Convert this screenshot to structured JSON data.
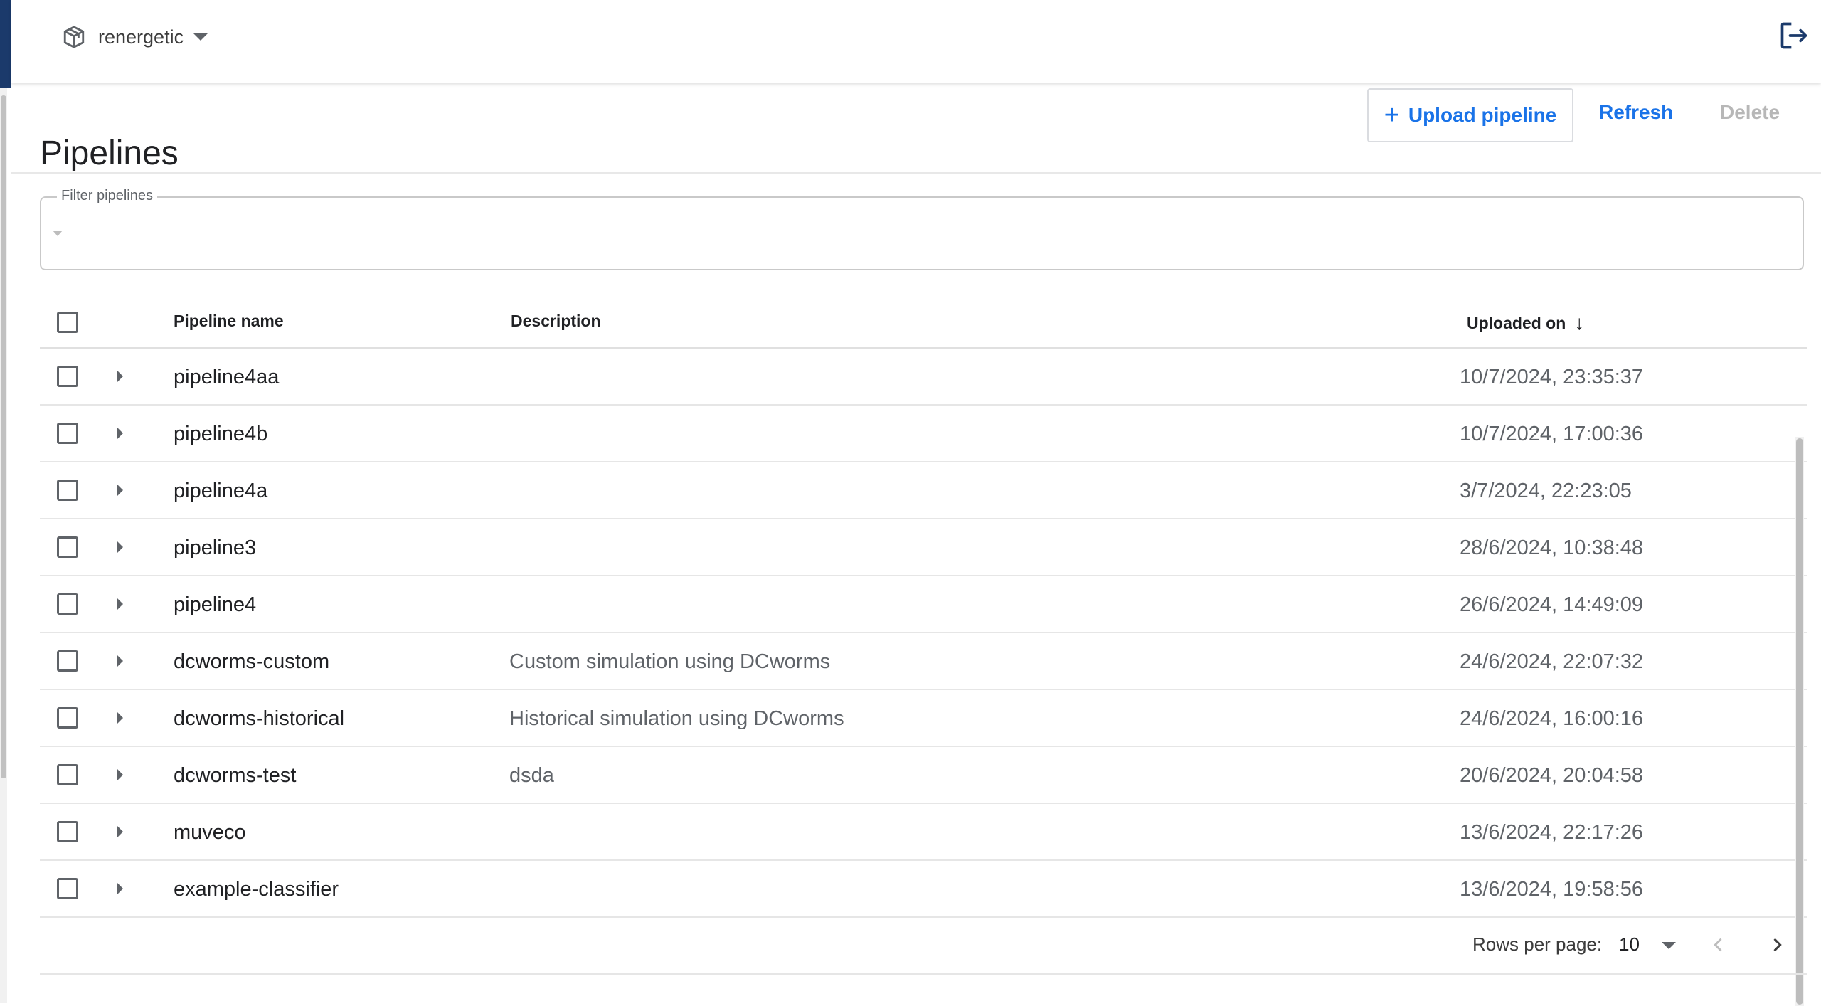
{
  "namespace": {
    "label": "renergetic",
    "icon": "package-icon"
  },
  "page": {
    "title": "Pipelines"
  },
  "actions": {
    "upload_label": "Upload pipeline",
    "refresh_label": "Refresh",
    "delete_label": "Delete"
  },
  "filter": {
    "label": "Filter pipelines"
  },
  "table": {
    "columns": {
      "name": "Pipeline name",
      "description": "Description",
      "uploaded": "Uploaded on"
    },
    "sort": {
      "column": "uploaded",
      "direction": "descending"
    },
    "rows": [
      {
        "name": "pipeline4aa",
        "description": "",
        "uploaded": "10/7/2024, 23:35:37"
      },
      {
        "name": "pipeline4b",
        "description": "",
        "uploaded": "10/7/2024, 17:00:36"
      },
      {
        "name": "pipeline4a",
        "description": "",
        "uploaded": "3/7/2024, 22:23:05"
      },
      {
        "name": "pipeline3",
        "description": "",
        "uploaded": "28/6/2024, 10:38:48"
      },
      {
        "name": "pipeline4",
        "description": "",
        "uploaded": "26/6/2024, 14:49:09"
      },
      {
        "name": "dcworms-custom",
        "description": "Custom simulation using DCworms",
        "uploaded": "24/6/2024, 22:07:32"
      },
      {
        "name": "dcworms-historical",
        "description": "Historical simulation using DCworms",
        "uploaded": "24/6/2024, 16:00:16"
      },
      {
        "name": "dcworms-test",
        "description": "dsda",
        "uploaded": "20/6/2024, 20:04:58"
      },
      {
        "name": "muveco",
        "description": "",
        "uploaded": "13/6/2024, 22:17:26"
      },
      {
        "name": "example-classifier",
        "description": "",
        "uploaded": "13/6/2024, 19:58:56"
      }
    ]
  },
  "pagination": {
    "rows_per_page_label": "Rows per page:",
    "rows_per_page": "10"
  },
  "colors": {
    "accent": "#1a73e8",
    "sidebar": "#1b3a6b",
    "disabled": "#b7b7b7"
  }
}
